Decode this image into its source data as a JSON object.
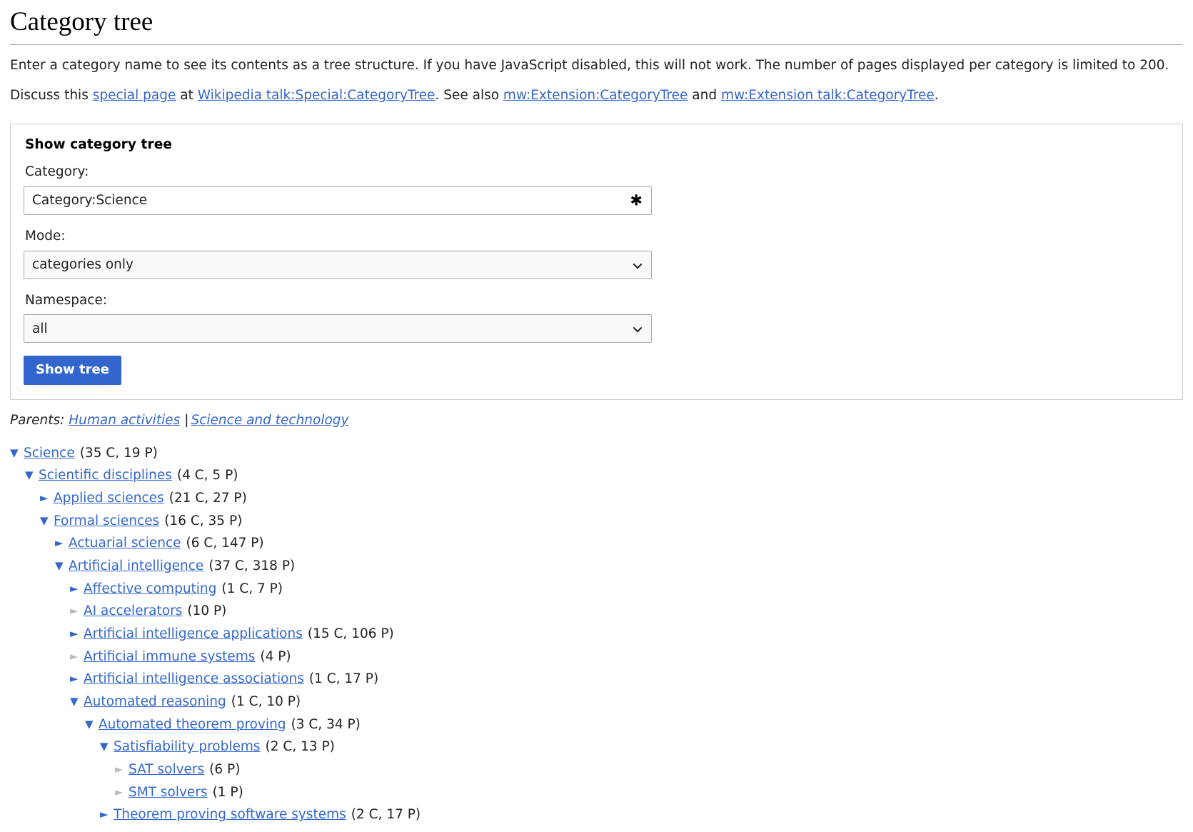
{
  "page": {
    "title": "Category tree"
  },
  "intro": {
    "paragraph1_part1": "Enter a category name to see its contents as a tree structure. If you have JavaScript disabled, this will not work. The number of pages displayed per category is limited to 200.",
    "paragraph2_part1": "Discuss this ",
    "link_special_page": "special page",
    "paragraph2_part2": " at ",
    "link_wikipedia_talk": "Wikipedia talk:Special:CategoryTree",
    "paragraph2_part3": ". See also ",
    "link_mw_extension": "mw:Extension:CategoryTree",
    "paragraph2_part4": " and ",
    "link_mw_extension_talk": "mw:Extension talk:CategoryTree",
    "paragraph2_part5": "."
  },
  "form": {
    "legend": "Show category tree",
    "category_label": "Category:",
    "category_value": "Category:Science",
    "category_placeholder": "",
    "category_suffix_icon": "asterisk-icon",
    "mode_label": "Mode:",
    "mode_value": "categories only",
    "mode_options": [
      "categories only"
    ],
    "namespace_label": "Namespace:",
    "namespace_value": "all",
    "namespace_options": [
      "all"
    ],
    "submit_label": "Show tree"
  },
  "parents": {
    "label": "Parents:",
    "separator": "|",
    "items": [
      {
        "label": "Human activities"
      },
      {
        "label": "Science and technology"
      }
    ]
  },
  "colors": {
    "link": "#3366cc",
    "progressive_button": "#3366cc",
    "border": "#a2a9b1",
    "bullet_disabled": "#b9bcc1",
    "text": "#202122"
  },
  "tree": {
    "items": [
      {
        "depth": 0,
        "state": "expanded",
        "bullet": "triangle-down-icon",
        "label": "Science",
        "count": "(35 C, 19 P)"
      },
      {
        "depth": 1,
        "state": "expanded",
        "bullet": "triangle-down-icon",
        "label": "Scientific disciplines",
        "count": "(4 C, 5 P)"
      },
      {
        "depth": 2,
        "state": "collapsed",
        "bullet": "triangle-right-icon",
        "label": "Applied sciences",
        "count": "(21 C, 27 P)"
      },
      {
        "depth": 2,
        "state": "expanded",
        "bullet": "triangle-down-icon",
        "label": "Formal sciences",
        "count": "(16 C, 35 P)"
      },
      {
        "depth": 3,
        "state": "collapsed",
        "bullet": "triangle-right-icon",
        "label": "Actuarial science",
        "count": "(6 C, 147 P)"
      },
      {
        "depth": 3,
        "state": "expanded",
        "bullet": "triangle-down-icon",
        "label": "Artificial intelligence",
        "count": "(37 C, 318 P)"
      },
      {
        "depth": 4,
        "state": "collapsed",
        "bullet": "triangle-right-icon",
        "label": "Affective computing",
        "count": "(1 C, 7 P)"
      },
      {
        "depth": 4,
        "state": "empty",
        "bullet": "triangle-right-icon",
        "label": "AI accelerators",
        "count": "(10 P)"
      },
      {
        "depth": 4,
        "state": "collapsed",
        "bullet": "triangle-right-icon",
        "label": "Artificial intelligence applications",
        "count": "(15 C, 106 P)"
      },
      {
        "depth": 4,
        "state": "empty",
        "bullet": "triangle-right-icon",
        "label": "Artificial immune systems",
        "count": "(4 P)"
      },
      {
        "depth": 4,
        "state": "collapsed",
        "bullet": "triangle-right-icon",
        "label": "Artificial intelligence associations",
        "count": "(1 C, 17 P)"
      },
      {
        "depth": 4,
        "state": "expanded",
        "bullet": "triangle-down-icon",
        "label": "Automated reasoning",
        "count": "(1 C, 10 P)"
      },
      {
        "depth": 5,
        "state": "expanded",
        "bullet": "triangle-down-icon",
        "label": "Automated theorem proving",
        "count": "(3 C, 34 P)"
      },
      {
        "depth": 6,
        "state": "expanded",
        "bullet": "triangle-down-icon",
        "label": "Satisfiability problems",
        "count": "(2 C, 13 P)"
      },
      {
        "depth": 7,
        "state": "empty",
        "bullet": "triangle-right-icon",
        "label": "SAT solvers",
        "count": "(6 P)"
      },
      {
        "depth": 7,
        "state": "empty",
        "bullet": "triangle-right-icon",
        "label": "SMT solvers",
        "count": "(1 P)"
      },
      {
        "depth": 6,
        "state": "collapsed",
        "bullet": "triangle-right-icon",
        "label": "Theorem proving software systems",
        "count": "(2 C, 17 P)"
      }
    ]
  }
}
